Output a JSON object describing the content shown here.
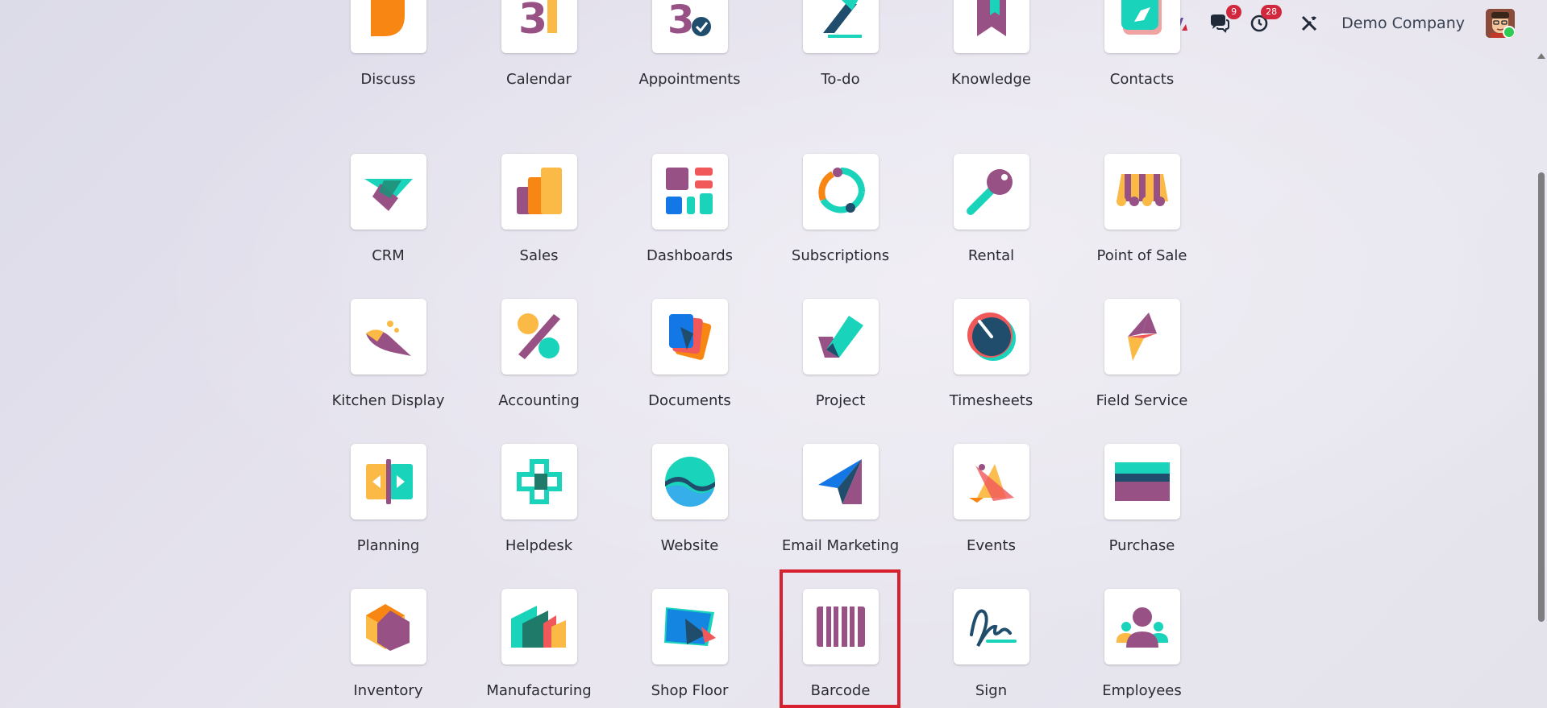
{
  "topbar": {
    "company_name": "Demo Company",
    "messages_count": "9",
    "activities_count": "28",
    "icons": [
      "ai-icon",
      "chat-icon",
      "clock-icon",
      "tools-icon",
      "avatar"
    ]
  },
  "apps_row0": [
    "Discuss",
    "Calendar",
    "Appointments",
    "To-do",
    "Knowledge",
    "Contacts"
  ],
  "apps_row1": [
    "CRM",
    "Sales",
    "Dashboards",
    "Subscriptions",
    "Rental",
    "Point of Sale"
  ],
  "apps_row2": [
    "Kitchen Display",
    "Accounting",
    "Documents",
    "Project",
    "Timesheets",
    "Field Service"
  ],
  "apps_row3": [
    "Planning",
    "Helpdesk",
    "Website",
    "Email Marketing",
    "Events",
    "Purchase"
  ],
  "apps_row4": [
    "Inventory",
    "Manufacturing",
    "Shop Floor",
    "Barcode",
    "Sign",
    "Employees"
  ],
  "highlighted_app": "Barcode",
  "colors": {
    "highlight": "#d7212e",
    "badge": "#d2283d",
    "purple": "#985184",
    "teal": "#1ad3bb",
    "orange": "#f78613",
    "yellow": "#fbb945",
    "navy": "#1f4d6b"
  }
}
